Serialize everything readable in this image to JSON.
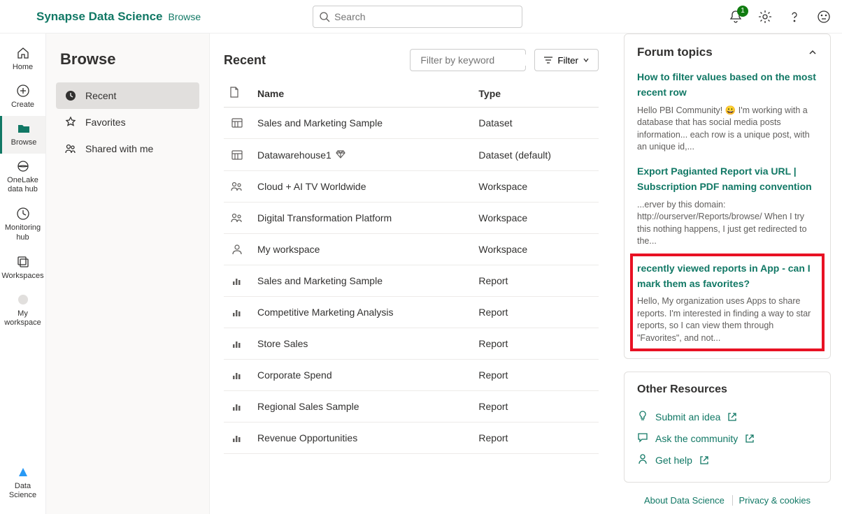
{
  "header": {
    "product_name": "Synapse Data Science",
    "section": "Browse",
    "search_placeholder": "Search",
    "notification_badge": "1"
  },
  "rail": [
    {
      "key": "home",
      "label": "Home"
    },
    {
      "key": "create",
      "label": "Create"
    },
    {
      "key": "browse",
      "label": "Browse"
    },
    {
      "key": "onelake",
      "label": "OneLake data hub"
    },
    {
      "key": "monitoring",
      "label": "Monitoring hub"
    },
    {
      "key": "workspaces",
      "label": "Workspaces"
    },
    {
      "key": "myworkspace",
      "label": "My workspace"
    }
  ],
  "rail_bottom": {
    "key": "datascience",
    "label": "Data Science"
  },
  "browse": {
    "title": "Browse",
    "items": [
      {
        "key": "recent",
        "label": "Recent"
      },
      {
        "key": "favorites",
        "label": "Favorites"
      },
      {
        "key": "shared",
        "label": "Shared with me"
      }
    ]
  },
  "content": {
    "heading": "Recent",
    "filter_placeholder": "Filter by keyword",
    "filter_button": "Filter",
    "col_icon": "",
    "col_name": "Name",
    "col_type": "Type",
    "rows": [
      {
        "icon": "dataset",
        "name": "Sales and Marketing Sample",
        "type": "Dataset",
        "has_diamond": false
      },
      {
        "icon": "dataset",
        "name": "Datawarehouse1",
        "type": "Dataset (default)",
        "has_diamond": true
      },
      {
        "icon": "workspace",
        "name": "Cloud + AI TV Worldwide",
        "type": "Workspace",
        "has_diamond": false
      },
      {
        "icon": "workspace",
        "name": "Digital Transformation Platform",
        "type": "Workspace",
        "has_diamond": false
      },
      {
        "icon": "workspace-single",
        "name": "My workspace",
        "type": "Workspace",
        "has_diamond": false
      },
      {
        "icon": "report",
        "name": "Sales and Marketing Sample",
        "type": "Report",
        "has_diamond": false
      },
      {
        "icon": "report",
        "name": "Competitive Marketing Analysis",
        "type": "Report",
        "has_diamond": false
      },
      {
        "icon": "report",
        "name": "Store Sales",
        "type": "Report",
        "has_diamond": false
      },
      {
        "icon": "report",
        "name": "Corporate Spend",
        "type": "Report",
        "has_diamond": false
      },
      {
        "icon": "report",
        "name": "Regional Sales Sample",
        "type": "Report",
        "has_diamond": false
      },
      {
        "icon": "report",
        "name": "Revenue Opportunities",
        "type": "Report",
        "has_diamond": false
      }
    ]
  },
  "forum": {
    "heading": "Forum topics",
    "topics": [
      {
        "title": "How to filter values based on the most recent row",
        "snippet": "Hello PBI Community! 😀 I'm working with a database that has social media posts information... each row is a unique post, with an unique id,...",
        "highlight": false
      },
      {
        "title": "Export Pagianted Report via URL | Subscription PDF naming convention",
        "snippet": "...erver by this domain: http://ourserver/Reports/browse/ When I try this nothing happens, I just get redirected to the...",
        "highlight": false
      },
      {
        "title": "recently viewed reports in App - can I mark them as favorites?",
        "snippet": "Hello, My organization uses Apps to share reports. I'm interested in finding a way to star reports, so I can view them through \"Favorites\", and not...",
        "highlight": true
      }
    ]
  },
  "other": {
    "heading": "Other Resources",
    "links": [
      {
        "icon": "bulb",
        "label": "Submit an idea"
      },
      {
        "icon": "chat",
        "label": "Ask the community"
      },
      {
        "icon": "person",
        "label": "Get help"
      }
    ]
  },
  "footer": {
    "about": "About Data Science",
    "privacy": "Privacy & cookies"
  }
}
